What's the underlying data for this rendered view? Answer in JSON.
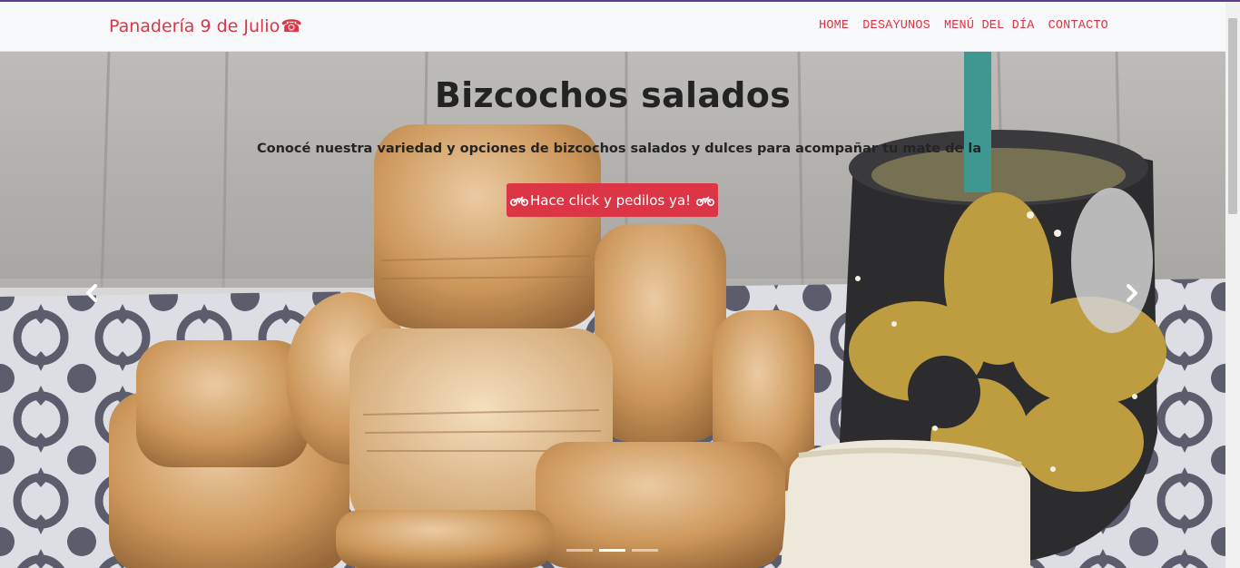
{
  "navbar": {
    "brand": "Panadería 9 de Julio",
    "brand_icon": "telephone-icon",
    "links": [
      "HOME",
      "DESAYUNOS",
      "MENÚ DEL DÍA",
      "CONTACTO"
    ]
  },
  "carousel": {
    "title": "Bizcochos salados",
    "text": "Conocé nuestra variedad y opciones de bizcochos salados y dulces para acompañar tu mate de la tarde",
    "button_label": "Hace click y pedilos ya!",
    "button_icon": "motorcycle-icon",
    "prev_icon": "chevron-left-icon",
    "next_icon": "chevron-right-icon",
    "slide_count": 3,
    "active_slide": 2
  },
  "colors": {
    "accent": "#dc3545",
    "navbar_bg": "#f8f9fb"
  }
}
